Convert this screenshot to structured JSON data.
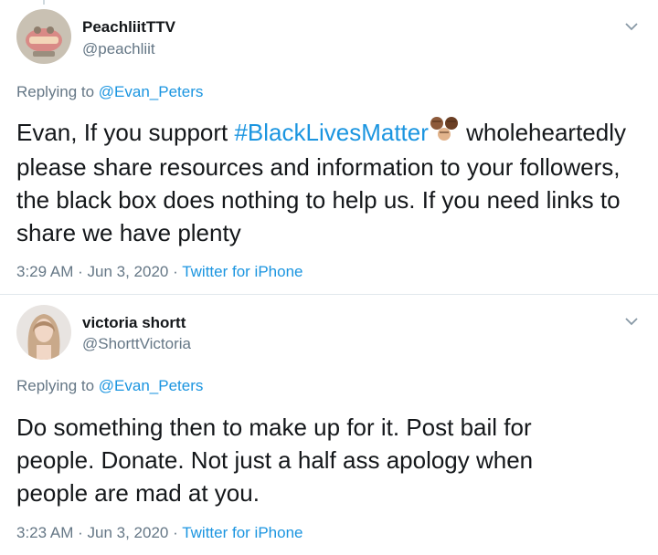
{
  "tweets": [
    {
      "display_name": "PeachliitTTV",
      "handle": "@peachliit",
      "replying_prefix": "Replying to",
      "replying_to": "@Evan_Peters",
      "text_before": "Evan, If you support ",
      "hashtag": "#BlackLivesMatter",
      "text_after": " wholeheartedly please share resources and information to your followers, the black box does nothing to help us. If you need links to share we have plenty",
      "emoji": "fist-emoji",
      "time": "3:29 AM",
      "date": "Jun 3, 2020",
      "source": "Twitter for iPhone",
      "separator": "·"
    },
    {
      "display_name": "victoria shortt",
      "handle": "@ShorttVictoria",
      "replying_prefix": "Replying to",
      "replying_to": "@Evan_Peters",
      "text": "Do something then to make up for it. Post bail for people. Donate. Not just a half ass apology when people are mad at you.",
      "time": "3:23 AM",
      "date": "Jun 3, 2020",
      "source": "Twitter for iPhone",
      "separator": "·"
    }
  ],
  "colors": {
    "link": "#1b95e0",
    "muted": "#657786",
    "text": "#14171a",
    "divider": "#e1e8ed"
  },
  "icons": [
    "chevron-down-icon",
    "fist-emoji-icon"
  ]
}
